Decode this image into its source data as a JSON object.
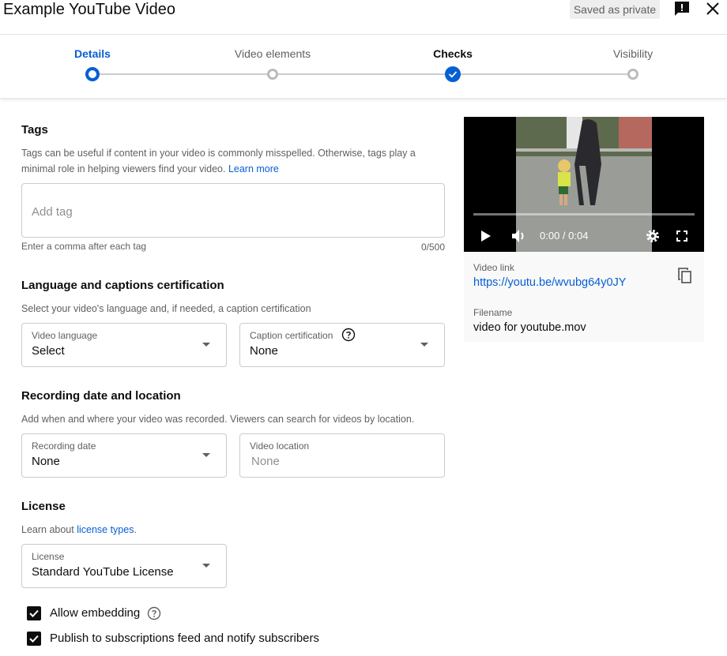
{
  "header": {
    "title": "Example YouTube Video",
    "saved_status": "Saved as private"
  },
  "stepper": {
    "steps": [
      {
        "label": "Details",
        "state": "current"
      },
      {
        "label": "Video elements",
        "state": "pending"
      },
      {
        "label": "Checks",
        "state": "done"
      },
      {
        "label": "Visibility",
        "state": "pending"
      }
    ]
  },
  "tags": {
    "title": "Tags",
    "description": "Tags can be useful if content in your video is commonly misspelled. Otherwise, tags play a minimal role in helping viewers find your video.",
    "learn_more": "Learn more",
    "placeholder": "Add tag",
    "hint": "Enter a comma after each tag",
    "counter": "0/500"
  },
  "language": {
    "title": "Language and captions certification",
    "description": "Select your video's language and, if needed, a caption certification",
    "video_language_label": "Video language",
    "video_language_value": "Select",
    "caption_label": "Caption certification",
    "caption_value": "None"
  },
  "recording": {
    "title": "Recording date and location",
    "description": "Add when and where your video was recorded. Viewers can search for videos by location.",
    "date_label": "Recording date",
    "date_value": "None",
    "location_label": "Video location",
    "location_placeholder": "None"
  },
  "license": {
    "title": "License",
    "learn_prefix": "Learn about ",
    "learn_link": "license types",
    "learn_suffix": ".",
    "label": "License",
    "value": "Standard YouTube License"
  },
  "options": {
    "allow_embedding": "Allow embedding",
    "allow_embedding_checked": true,
    "publish_feed": "Publish to subscriptions feed and notify subscribers",
    "publish_feed_checked": true
  },
  "video": {
    "time": "0:00 / 0:04",
    "progress": 0,
    "link_label": "Video link",
    "link_url": "https://youtu.be/wvubg64y0JY",
    "filename_label": "Filename",
    "filename": "video for youtube.mov"
  },
  "colors": {
    "accent": "#065fd4",
    "text": "#0d0d0d",
    "secondary": "#606060"
  }
}
